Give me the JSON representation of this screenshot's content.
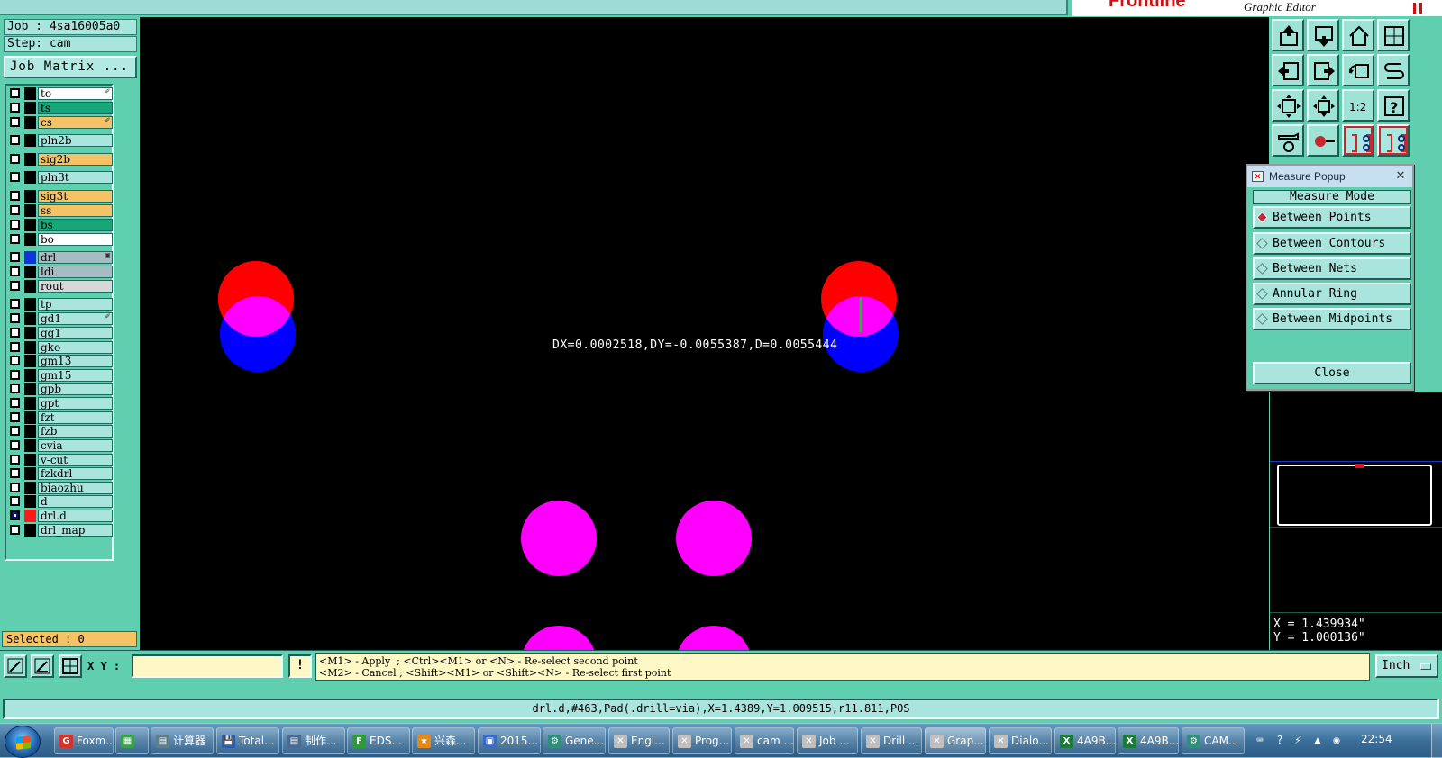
{
  "brand": {
    "logo": "Frontline",
    "subtitle": "Graphic Editor"
  },
  "job": {
    "job_label": "Job : 4sa16005a0",
    "step_label": "Step: cam",
    "matrix_button": "Job Matrix ..."
  },
  "layers": [
    {
      "name": "to",
      "color": "#ffffff",
      "mark": "✐"
    },
    {
      "name": "ts",
      "color": "#17a67a",
      "mark": ""
    },
    {
      "name": "cs",
      "color": "#f5c265",
      "mark": "✐"
    },
    {
      "name": "pln2b",
      "color": "#a9e4dd",
      "mark": ""
    },
    {
      "name": "sig2b",
      "color": "#f5c265",
      "mark": ""
    },
    {
      "name": "pln3t",
      "color": "#a9e4dd",
      "mark": ""
    },
    {
      "name": "sig3t",
      "color": "#f5c265",
      "mark": ""
    },
    {
      "name": "ss",
      "color": "#f5c265",
      "mark": ""
    },
    {
      "name": "bs",
      "color": "#17a67a",
      "mark": ""
    },
    {
      "name": "bo",
      "color": "#ffffff",
      "mark": ""
    },
    {
      "name": "drl",
      "color": "#a6bcc2",
      "mark": "▣"
    },
    {
      "name": "ldi",
      "color": "#a6bcc2",
      "mark": ""
    },
    {
      "name": "rout",
      "color": "#d8d8d8",
      "mark": ""
    },
    {
      "name": "tp",
      "color": "#a9e4dd",
      "mark": ""
    },
    {
      "name": "gd1",
      "color": "#a9e4dd",
      "mark": "✐"
    },
    {
      "name": "gg1",
      "color": "#a9e4dd",
      "mark": ""
    },
    {
      "name": "gko",
      "color": "#a9e4dd",
      "mark": ""
    },
    {
      "name": "gm13",
      "color": "#a9e4dd",
      "mark": ""
    },
    {
      "name": "gm15",
      "color": "#a9e4dd",
      "mark": ""
    },
    {
      "name": "gpb",
      "color": "#a9e4dd",
      "mark": ""
    },
    {
      "name": "gpt",
      "color": "#a9e4dd",
      "mark": ""
    },
    {
      "name": "fzt",
      "color": "#a9e4dd",
      "mark": ""
    },
    {
      "name": "fzb",
      "color": "#a9e4dd",
      "mark": ""
    },
    {
      "name": "cvia",
      "color": "#a9e4dd",
      "mark": ""
    },
    {
      "name": "v-cut",
      "color": "#a9e4dd",
      "mark": ""
    },
    {
      "name": "fzkdrl",
      "color": "#a9e4dd",
      "mark": ""
    },
    {
      "name": "biaozhu",
      "color": "#a9e4dd",
      "mark": ""
    },
    {
      "name": "d",
      "color": "#a9e4dd",
      "mark": ""
    },
    {
      "name": "drl.d",
      "color": "#a9e4dd",
      "mark": ""
    },
    {
      "name": "drl_map",
      "color": "#a9e4dd",
      "mark": ""
    }
  ],
  "selected_label": "Selected : 0",
  "canvas": {
    "measure_readout": "DX=0.0002518,DY=-0.0055387,D=0.0055444"
  },
  "measure_popup": {
    "title": "Measure Popup",
    "mode_header": "Measure Mode",
    "options": [
      "Between Points",
      "Between Contours",
      "Between Nets",
      "Annular Ring",
      "Between Midpoints"
    ],
    "selected_option": "Between Points",
    "close_label": "Close"
  },
  "coords": {
    "x": "X = 1.439934\"",
    "y": "Y = 1.000136\""
  },
  "command": {
    "xy_label": "X Y :",
    "xy_value": "",
    "info_label": "!",
    "message_line1": "<M1> - Apply  ; <Ctrl><M1> or <N> - Re-select second point",
    "message_line2": "<M2> - Cancel ; <Shift><M1> or <Shift><N> - Re-select first point",
    "unit": "Inch"
  },
  "status_line": "drl.d,#463,Pad(.drill=via),X=1.4389,Y=1.009515,r11.811,POS",
  "taskbar": {
    "items": [
      {
        "label": "Foxm...",
        "icon_color": "#d0342c",
        "icon": "G"
      },
      {
        "label": "",
        "icon_color": "#3aa04a",
        "icon": "▦"
      },
      {
        "label": "计算器",
        "icon_color": "#607d8b",
        "icon": "▤"
      },
      {
        "label": "Total...",
        "icon_color": "#2a5db0",
        "icon": "💾"
      },
      {
        "label": "制作...",
        "icon_color": "#4a6a90",
        "icon": "▤"
      },
      {
        "label": "EDS...",
        "icon_color": "#2e9b3a",
        "icon": "F"
      },
      {
        "label": "兴森...",
        "icon_color": "#e08a1e",
        "icon": "★"
      },
      {
        "label": "2015...",
        "icon_color": "#3b6cc0",
        "icon": "▣"
      },
      {
        "label": "Gene...",
        "icon_color": "#2f8f7a",
        "icon": "⚙"
      },
      {
        "label": "Engi...",
        "icon_color": "#c0c0c0",
        "icon": "✕"
      },
      {
        "label": "Prog...",
        "icon_color": "#c0c0c0",
        "icon": "✕"
      },
      {
        "label": "cam ...",
        "icon_color": "#c0c0c0",
        "icon": "✕"
      },
      {
        "label": "Job ...",
        "icon_color": "#c0c0c0",
        "icon": "✕"
      },
      {
        "label": "Drill ...",
        "icon_color": "#c0c0c0",
        "icon": "✕"
      },
      {
        "label": "Grap...",
        "icon_color": "#c0c0c0",
        "icon": "✕"
      },
      {
        "label": "Dialo...",
        "icon_color": "#c0c0c0",
        "icon": "✕"
      },
      {
        "label": "4A9B...",
        "icon_color": "#1d7a3a",
        "icon": "X"
      },
      {
        "label": "4A9B...",
        "icon_color": "#1d7a3a",
        "icon": "X"
      },
      {
        "label": "CAM...",
        "icon_color": "#2f8f7a",
        "icon": "⚙"
      }
    ],
    "clock": "22:54"
  }
}
